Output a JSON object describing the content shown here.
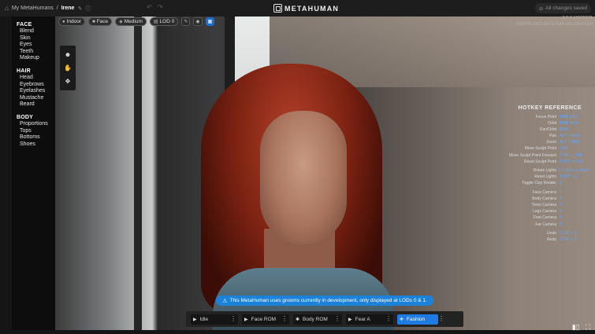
{
  "breadcrumb": {
    "root": "My MetaHumans",
    "separator": "/",
    "current": "Irene"
  },
  "app": {
    "logo_text": "METAHUMAN"
  },
  "status": {
    "saved": "All changes saved"
  },
  "version": {
    "line1": "2.0.0-15976371",
    "line2": "ff28f795-8550-5e7a-3af4-c56c08a7e16f"
  },
  "sidebar": {
    "sections": [
      {
        "label": "FACE",
        "items": [
          "Blend",
          "Skin",
          "Eyes",
          "Teeth",
          "Makeup"
        ]
      },
      {
        "label": "HAIR",
        "items": [
          "Head",
          "Eyebrows",
          "Eyelashes",
          "Mustache",
          "Beard"
        ]
      },
      {
        "label": "BODY",
        "items": [
          "Proportions",
          "Tops",
          "Bottoms",
          "Shoes"
        ]
      }
    ]
  },
  "viewport_chips": {
    "lighting": "Indoor",
    "camera": "Face",
    "quality": "Medium",
    "lod": "LOD 0"
  },
  "hotkeys": {
    "title": "HOTKEY REFERENCE",
    "groups": [
      [
        {
          "label": "Focus Point",
          "key": "RMB Click"
        },
        {
          "label": "Orbit",
          "key": "RMB Hold"
        },
        {
          "label": "Pan/Orbit",
          "key": "MMB"
        },
        {
          "label": "Pan",
          "key": "ALT + MMB"
        },
        {
          "label": "Zoom",
          "key": "ALT + RMB"
        },
        {
          "label": "Move Sculpt Point",
          "key": "LMB"
        },
        {
          "label": "Move Sculpt Point Forward",
          "key": "CTRL + LMB"
        },
        {
          "label": "Reset Sculpt Point",
          "key": "SHIFT + LMB"
        }
      ],
      [
        {
          "label": "Rotate Lights",
          "key": "L + Mouse Move"
        },
        {
          "label": "Reset Lights",
          "key": "SHIFT + L"
        },
        {
          "label": "Toggle Clay Render",
          "key": "C"
        }
      ],
      [
        {
          "label": "Face Camera",
          "key": "1"
        },
        {
          "label": "Body Camera",
          "key": "2"
        },
        {
          "label": "Torso Camera",
          "key": "3"
        },
        {
          "label": "Legs Camera",
          "key": "4"
        },
        {
          "label": "Feet Camera",
          "key": "5"
        },
        {
          "label": "Far Camera",
          "key": "6"
        }
      ],
      [
        {
          "label": "Undo",
          "key": "CTRL + Z"
        },
        {
          "label": "Redo",
          "key": "CTRL + Y"
        }
      ]
    ]
  },
  "banner": {
    "text": "This MetaHuman uses grooms currently in development, only displayed at LODs 0 & 1."
  },
  "animation_bar": {
    "pose": "Idle",
    "face_rom": "Face ROM",
    "body_rom": "Body ROM",
    "expression": "Fear A",
    "outfit": "Fashion"
  },
  "icons": [
    "home-icon",
    "edit-icon",
    "help-icon",
    "undo-icon",
    "redo-icon",
    "check-icon",
    "bulb-icon",
    "camera-icon",
    "quality-icon",
    "lod-icon",
    "head-tool-icon",
    "hand-tool-icon",
    "move-tool-icon",
    "warning-icon",
    "play-icon",
    "fullscreen-icon",
    "stats-icon"
  ],
  "colors": {
    "accent": "#1c82d9",
    "hotkey_key": "#61a6ff",
    "panel": "#0d0d0d"
  }
}
